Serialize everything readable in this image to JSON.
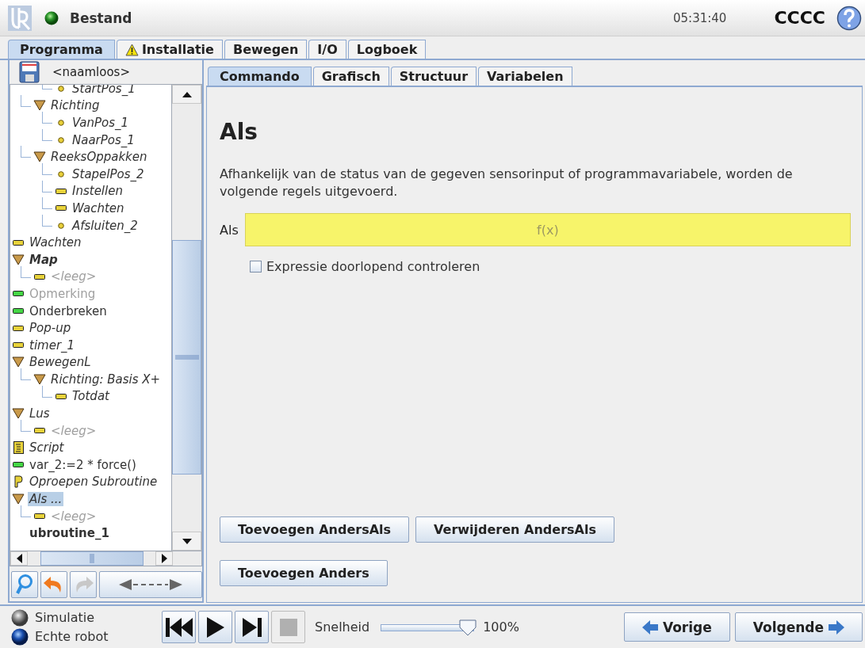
{
  "topbar": {
    "menu": "Bestand",
    "time": "05:31:40",
    "robot_name": "CCCC"
  },
  "main_tabs": [
    {
      "label": "Programma",
      "selected": true,
      "warning": false
    },
    {
      "label": "Installatie",
      "selected": false,
      "warning": true
    },
    {
      "label": "Bewegen",
      "selected": false,
      "warning": false
    },
    {
      "label": "I/O",
      "selected": false,
      "warning": false
    },
    {
      "label": "Logboek",
      "selected": false,
      "warning": false
    }
  ],
  "program": {
    "name": "<naamloos>",
    "tree": [
      {
        "children": [
          {
            "children": [
              {
                "label": "StartPos_1",
                "kind": "waypoint",
                "disabled": false,
                "selected": false
              }
            ]
          },
          {
            "label": "Richting",
            "kind": "group",
            "disabled": false,
            "selected": false,
            "children": [
              {
                "label": "VanPos_1",
                "kind": "waypoint",
                "disabled": false,
                "selected": false
              },
              {
                "label": "NaarPos_1",
                "kind": "waypoint",
                "disabled": false,
                "selected": false
              }
            ]
          },
          {
            "label": "ReeksOppakken",
            "kind": "group",
            "disabled": false,
            "selected": false,
            "children": [
              {
                "label": "StapelPos_2",
                "kind": "waypoint",
                "disabled": false,
                "selected": false
              },
              {
                "label": "Instellen",
                "kind": "action",
                "disabled": false,
                "selected": false
              },
              {
                "label": "Wachten",
                "kind": "action",
                "disabled": false,
                "selected": false
              },
              {
                "label": "Afsluiten_2",
                "kind": "waypoint",
                "disabled": false,
                "selected": false
              }
            ]
          }
        ]
      },
      {
        "label": "Wachten",
        "kind": "action",
        "disabled": false,
        "selected": false
      },
      {
        "label": "Map",
        "kind": "folder",
        "disabled": false,
        "selected": false,
        "children": [
          {
            "label": "<leeg>",
            "kind": "action",
            "disabled": true,
            "selected": false
          }
        ]
      },
      {
        "label": "Opmerking",
        "kind": "statement",
        "disabled": true,
        "selected": false
      },
      {
        "label": "Onderbreken",
        "kind": "statement",
        "disabled": false,
        "selected": false
      },
      {
        "label": "Pop-up",
        "kind": "action",
        "disabled": false,
        "selected": false
      },
      {
        "label": "timer_1",
        "kind": "action",
        "disabled": false,
        "selected": false
      },
      {
        "label": "BewegenL",
        "kind": "group",
        "disabled": false,
        "selected": false,
        "children": [
          {
            "label": "Richting: Basis X+",
            "kind": "group",
            "disabled": false,
            "selected": false,
            "children": [
              {
                "label": "Totdat",
                "kind": "action",
                "disabled": false,
                "selected": false
              }
            ]
          }
        ]
      },
      {
        "label": "Lus",
        "kind": "group",
        "disabled": false,
        "selected": false,
        "children": [
          {
            "label": "<leeg>",
            "kind": "action",
            "disabled": true,
            "selected": false
          }
        ]
      },
      {
        "label": "Script",
        "kind": "script",
        "disabled": false,
        "selected": false
      },
      {
        "label": "var_2:=2 * force()",
        "kind": "statement",
        "disabled": false,
        "selected": false
      },
      {
        "label": "Oproepen Subroutine",
        "kind": "call",
        "disabled": false,
        "selected": false
      },
      {
        "label": "Als ...",
        "kind": "group",
        "disabled": false,
        "selected": true,
        "children": [
          {
            "label": "<leeg>",
            "kind": "action",
            "disabled": true,
            "selected": false
          }
        ]
      },
      {
        "label": "ubroutine_1",
        "kind": "subroutine",
        "disabled": false,
        "selected": false
      }
    ]
  },
  "tree_tools": [
    {
      "kind": "search",
      "disabled": false
    },
    {
      "kind": "undo",
      "disabled": false
    },
    {
      "kind": "redo",
      "disabled": true
    },
    {
      "kind": "move",
      "disabled": false
    }
  ],
  "sub_tabs": [
    {
      "label": "Commando",
      "selected": true
    },
    {
      "label": "Grafisch",
      "selected": false
    },
    {
      "label": "Structuur",
      "selected": false
    },
    {
      "label": "Variabelen",
      "selected": false
    }
  ],
  "command": {
    "title": "Als",
    "description": "Afhankelijk van de status van de gegeven sensorinput of programmavariabele, worden de volgende regels uitgevoerd.",
    "condition": {
      "label": "Als",
      "placeholder": "f(x)"
    },
    "continuous_check": {
      "label": "Expressie doorlopend controleren",
      "checked": false
    },
    "buttons": [
      [
        "Toevoegen AndersAls",
        "Verwijderen AndersAls"
      ],
      [
        "Toevoegen Anders"
      ]
    ]
  },
  "mode": [
    {
      "label": "Simulatie",
      "selected": false
    },
    {
      "label": "Echte robot",
      "selected": true
    }
  ],
  "transport": [
    {
      "kind": "previous",
      "disabled": false
    },
    {
      "kind": "play",
      "disabled": false
    },
    {
      "kind": "next",
      "disabled": false
    },
    {
      "kind": "stop",
      "disabled": true
    }
  ],
  "speed": {
    "label": "Snelheid",
    "level": 0.93,
    "reading": "100%"
  },
  "navigation": {
    "previous": "Vorige",
    "next": "Volgende"
  }
}
